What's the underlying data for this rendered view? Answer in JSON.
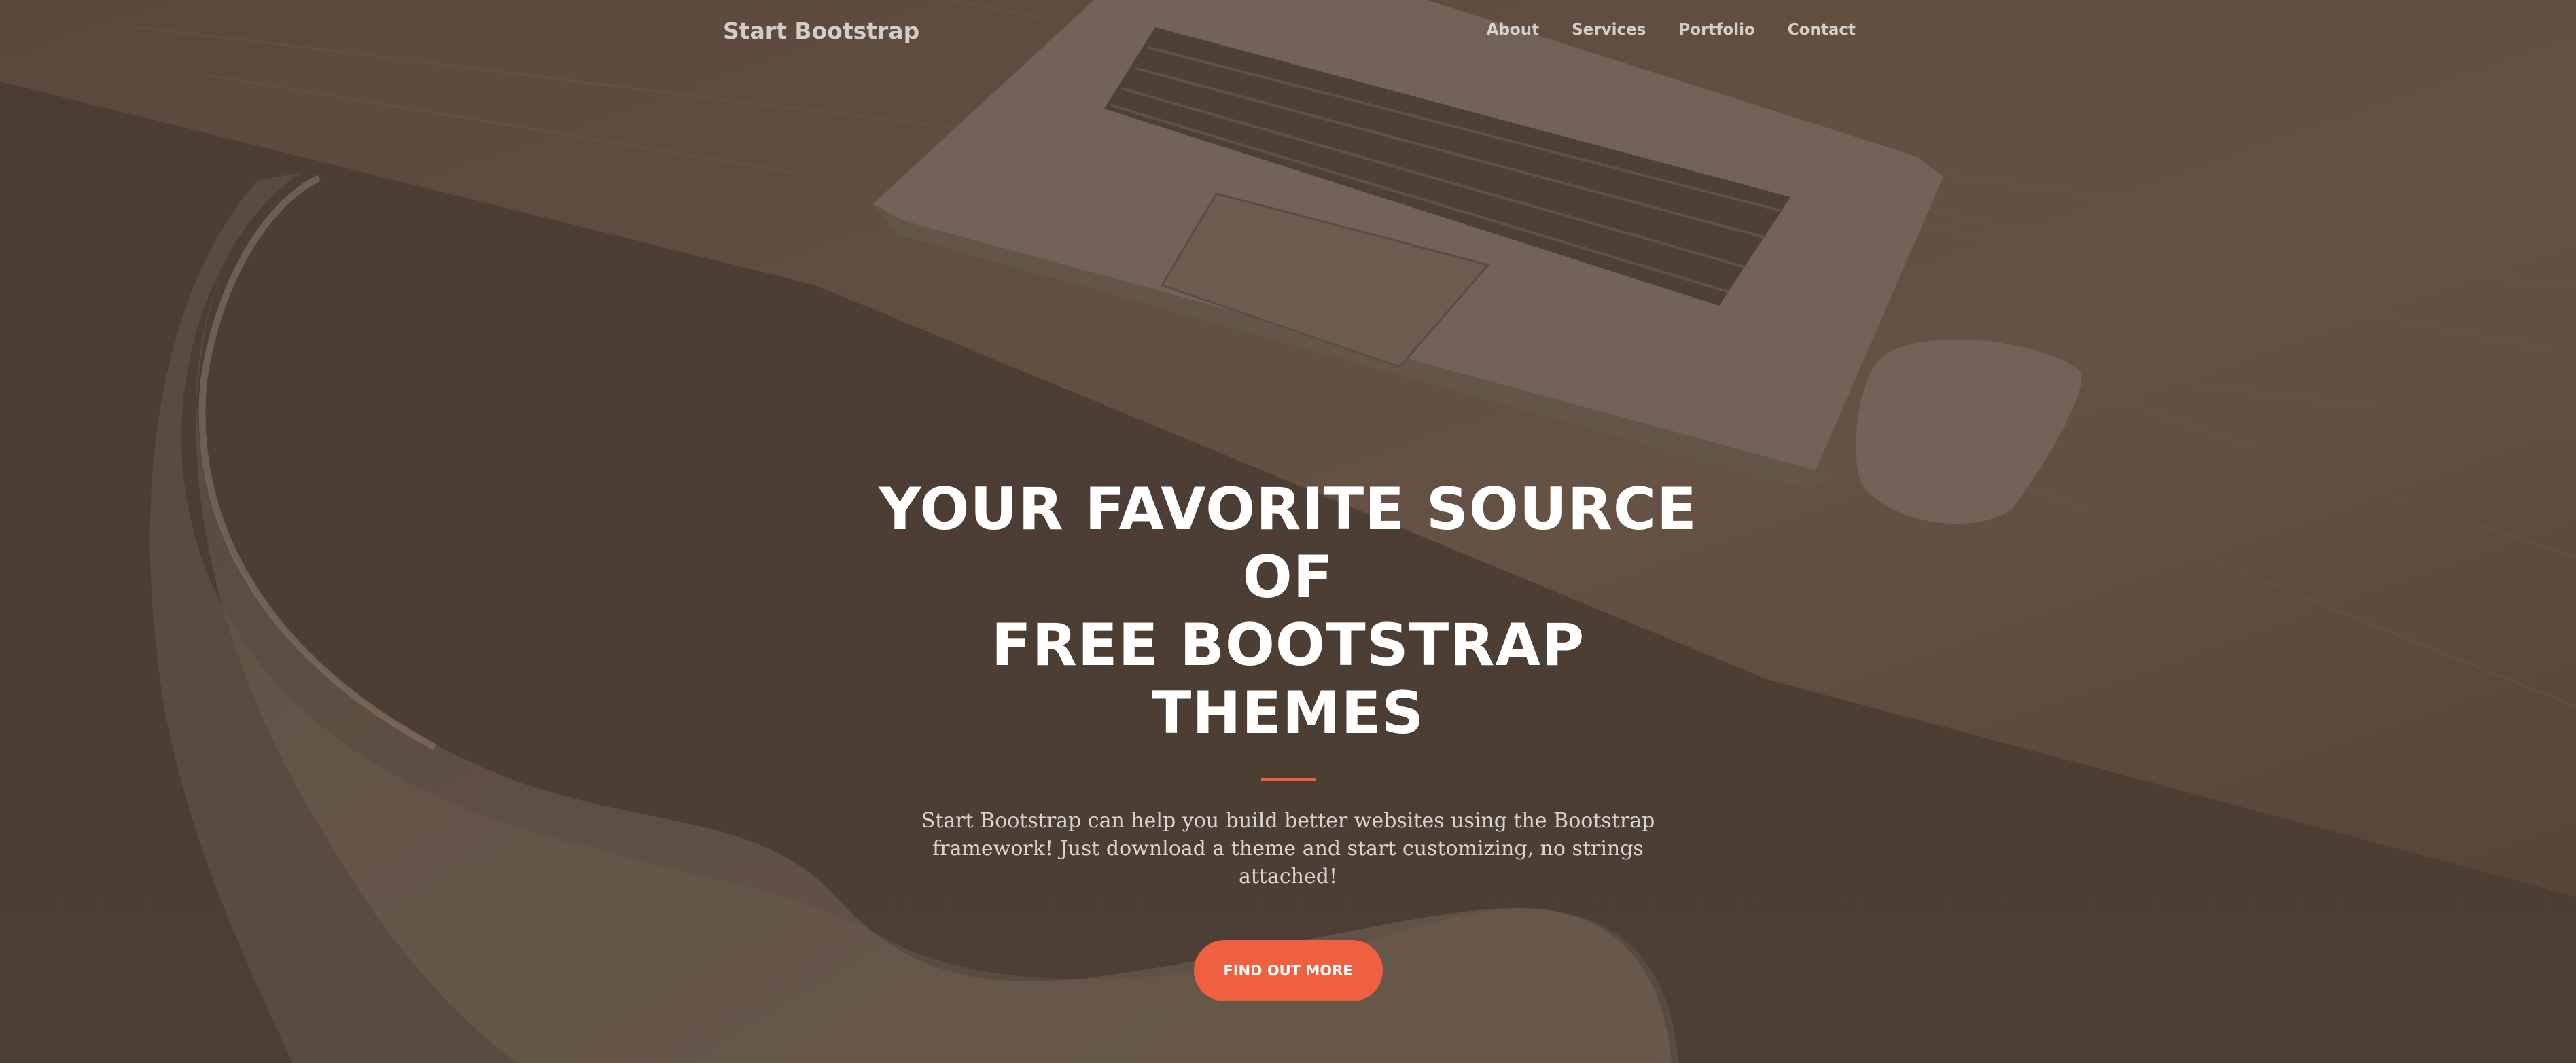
{
  "navbar": {
    "brand": "Start Bootstrap",
    "links": [
      "About",
      "Services",
      "Portfolio",
      "Contact"
    ]
  },
  "hero": {
    "title_line1": "YOUR FAVORITE SOURCE OF",
    "title_line2": "FREE BOOTSTRAP THEMES",
    "description": "Start Bootstrap can help you build better websites using the Bootstrap framework! Just download a theme and start customizing, no strings attached!",
    "cta_label": "Find Out More"
  },
  "colors": {
    "overlay": "#4f4036",
    "accent": "#f05f40",
    "text": "#ffffff"
  }
}
